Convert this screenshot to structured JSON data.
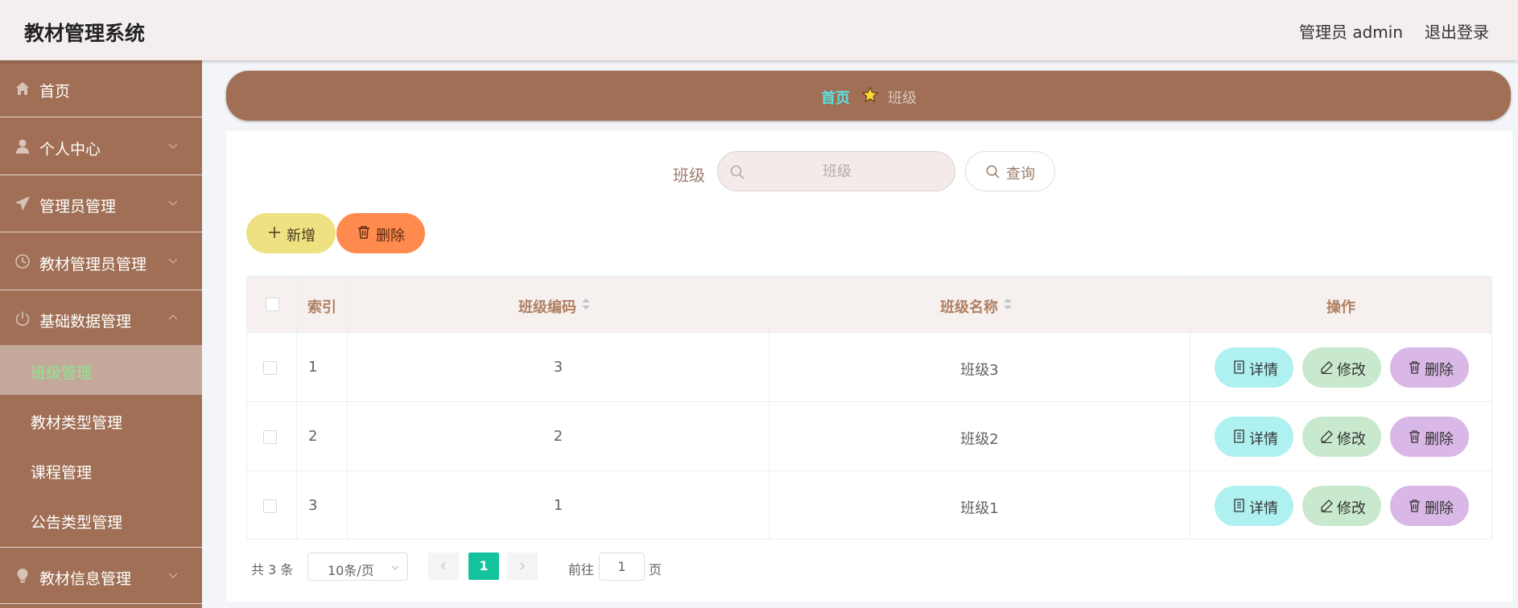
{
  "header": {
    "app_title": "教材管理系统",
    "user": "管理员 admin",
    "logout": "退出登录"
  },
  "sidebar": {
    "items": [
      {
        "label": "首页",
        "icon": "home-icon"
      },
      {
        "label": "个人中心",
        "icon": "user-icon"
      },
      {
        "label": "管理员管理",
        "icon": "send-icon"
      },
      {
        "label": "教材管理员管理",
        "icon": "clock-icon"
      },
      {
        "label": "基础数据管理",
        "icon": "power-icon",
        "expanded": true
      },
      {
        "label": "教材信息管理",
        "icon": "lightbulb-icon"
      }
    ],
    "sub_items": [
      {
        "label": "班级管理",
        "active": true
      },
      {
        "label": "教材类型管理"
      },
      {
        "label": "课程管理"
      },
      {
        "label": "公告类型管理"
      }
    ]
  },
  "breadcrumb": {
    "home": "首页",
    "current": "班级"
  },
  "search": {
    "label": "班级",
    "placeholder": "班级",
    "query_button": "查询"
  },
  "toolbar": {
    "add_label": "新增",
    "delete_label": "删除"
  },
  "table": {
    "columns": {
      "index": "索引",
      "code": "班级编码",
      "name": "班级名称",
      "actions": "操作"
    },
    "rows": [
      {
        "index": "1",
        "code": "3",
        "name": "班级3"
      },
      {
        "index": "2",
        "code": "2",
        "name": "班级2"
      },
      {
        "index": "3",
        "code": "1",
        "name": "班级1"
      }
    ],
    "actions": {
      "detail": "详情",
      "edit": "修改",
      "delete": "删除"
    }
  },
  "pagination": {
    "total": "共 3 条",
    "page_size": "10条/页",
    "current_page": "1",
    "goto_label": "前往",
    "goto_value": "1",
    "page_label": "页"
  },
  "colors": {
    "sidebar_bg": "#a06f55",
    "active_sub_text": "#8fe58f",
    "breadcrumb_home": "#5ce0e0",
    "pagination_active": "#13c39d",
    "add_button": "#ede182",
    "delete_button": "#ff8a4d"
  }
}
